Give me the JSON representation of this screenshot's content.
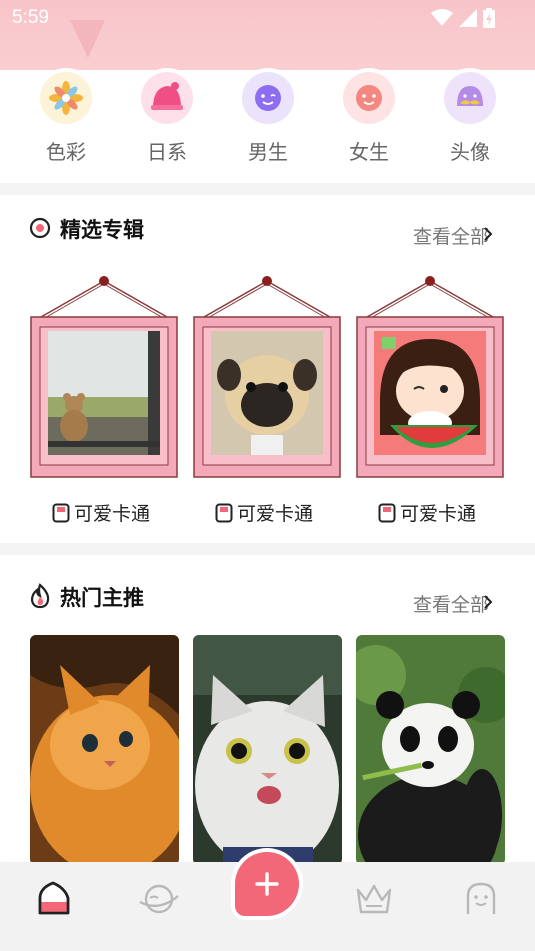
{
  "status_bar": {
    "time": "5:59"
  },
  "categories": [
    {
      "label": "色彩",
      "icon": "flower-icon"
    },
    {
      "label": "日系",
      "icon": "hat-icon"
    },
    {
      "label": "男生",
      "icon": "boy-face-icon"
    },
    {
      "label": "女生",
      "icon": "girl-face-icon"
    },
    {
      "label": "头像",
      "icon": "mustache-face-icon"
    }
  ],
  "featured": {
    "title": "精选专辑",
    "more": "查看全部",
    "items": [
      {
        "caption": "可爱卡通",
        "image": "teddy-bear-window-photo"
      },
      {
        "caption": "可爱卡通",
        "image": "pug-dog-photo"
      },
      {
        "caption": "可爱卡通",
        "image": "cartoon-girl-watermelon"
      }
    ]
  },
  "hot": {
    "title": "热门主推",
    "more": "查看全部",
    "items": [
      {
        "image": "orange-kitten-photo"
      },
      {
        "image": "white-cat-photo"
      },
      {
        "image": "panda-photo"
      }
    ]
  },
  "bottom_nav": [
    {
      "icon": "home-icon",
      "active": true
    },
    {
      "icon": "planet-icon",
      "active": false
    },
    {
      "icon": "add-icon",
      "active": false
    },
    {
      "icon": "crown-icon",
      "active": false
    },
    {
      "icon": "profile-icon",
      "active": false
    }
  ],
  "colors": {
    "accent": "#f26878",
    "banner": "#f9c8cc",
    "text_muted": "#777777"
  }
}
